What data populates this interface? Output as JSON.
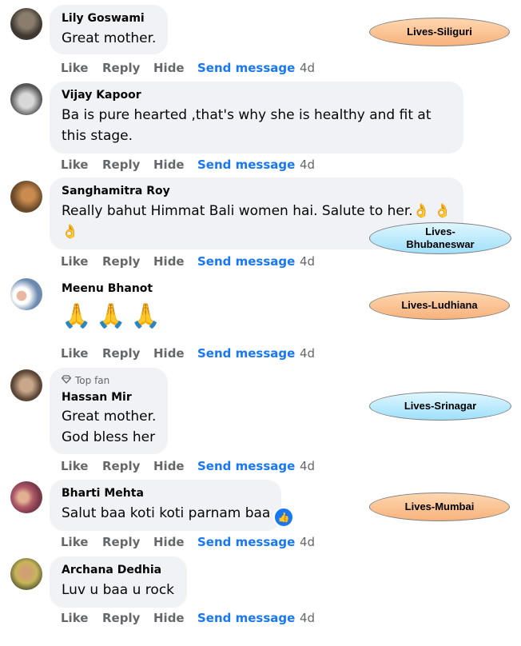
{
  "actions": {
    "like": "Like",
    "reply": "Reply",
    "hide": "Hide",
    "send": "Send message"
  },
  "comments": [
    {
      "name": "Lily Goswami",
      "text": "Great mother.",
      "time": "4d"
    },
    {
      "name": "Vijay Kapoor",
      "text_line1": "Ba is pure hearted ,that's why she is healthy and fit at",
      "text_line2": "this stage.",
      "time": "4d"
    },
    {
      "name": "Sanghamitra Roy",
      "text": "Really bahut Himmat Bali women hai. Salute to her.",
      "emoji": "👌",
      "time": "4d"
    },
    {
      "name": "Meenu Bhanot",
      "emoji": "🙏🙏🙏",
      "time": "4d"
    },
    {
      "badge": "Top fan",
      "name": "Hassan Mir",
      "text_line1": "Great mother.",
      "text_line2": "God bless her",
      "time": "4d"
    },
    {
      "name": "Bharti Mehta",
      "text": "Salut baa koti koti parnam baa",
      "reaction": "👍",
      "time": "4d"
    },
    {
      "name": "Archana Dedhia",
      "text": "Luv u baa u rock",
      "time": "4d"
    }
  ],
  "labels": {
    "siliguri": "Lives-Siliguri",
    "bhubaneswar_line1": "Lives-",
    "bhubaneswar_line2": "Bhubaneswar",
    "ludhiana": "Lives-Ludhiana",
    "srinagar": "Lives-Srinagar",
    "mumbai": "Lives-Mumbai"
  },
  "colors": {
    "bubble": "#f0f2f5",
    "action_text": "#65676b",
    "send_message": "#1877f2",
    "label_orange": "#f7b27c",
    "label_blue": "#9fe0fb"
  }
}
